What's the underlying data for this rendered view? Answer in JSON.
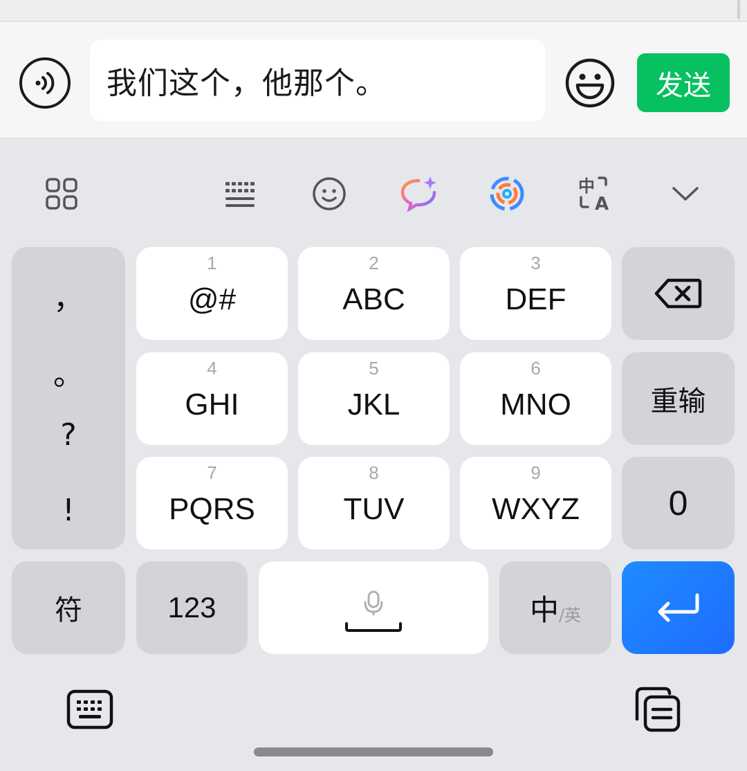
{
  "composer": {
    "message_text": "我们这个，他那个。",
    "send_label": "发送"
  },
  "toolbar": {
    "icons": [
      "apps-grid-icon",
      "keyboard-layout-icon",
      "emoji-face-icon",
      "ai-chat-sparkle-icon",
      "swirl-app-icon",
      "translate-icon",
      "chevron-down-icon"
    ]
  },
  "keyboard": {
    "punctuation": [
      "，",
      "。",
      "?",
      "!"
    ],
    "keys": [
      {
        "num": "1",
        "label": "@#"
      },
      {
        "num": "2",
        "label": "ABC"
      },
      {
        "num": "3",
        "label": "DEF"
      },
      {
        "num": "4",
        "label": "GHI"
      },
      {
        "num": "5",
        "label": "JKL"
      },
      {
        "num": "6",
        "label": "MNO"
      },
      {
        "num": "7",
        "label": "PQRS"
      },
      {
        "num": "8",
        "label": "TUV"
      },
      {
        "num": "9",
        "label": "WXYZ"
      }
    ],
    "retype_label": "重输",
    "zero_label": "0",
    "symbols_label": "符",
    "numbers_label": "123",
    "lang_main": "中",
    "lang_alt": "/英"
  },
  "colors": {
    "send_green": "#07c160",
    "enter_blue": "#1f6cff"
  }
}
